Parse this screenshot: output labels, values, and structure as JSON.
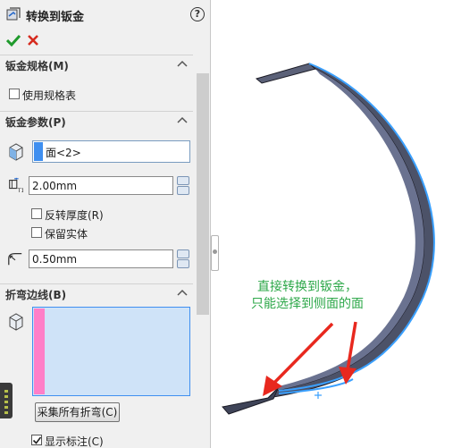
{
  "title": "转换到钣金",
  "icons": {
    "title": "sheetmetal-convert-icon",
    "help": "help-icon",
    "ok": "checkmark-icon",
    "cancel": "cancel-icon"
  },
  "colors": {
    "panel_bg": "#f0f0f0",
    "face_swatch": "#3f8ff0",
    "bend_swatch": "#ff7fc8",
    "bend_list_bg": "#cfe3f8",
    "annotation": "#2ea84a",
    "arrow": "#e8281e",
    "part": "#4c5268",
    "edge_highlight": "#3aa0ff"
  },
  "help_glyph": "?",
  "groups": {
    "gauge": {
      "header": "钣金规格(M)",
      "use_gauge_table": {
        "label": "使用规格表",
        "checked": false
      }
    },
    "params": {
      "header": "钣金参数(P)",
      "fixed_face": "面<2>",
      "thickness": "2.00mm",
      "reverse_thickness": {
        "label": "反转厚度(R)",
        "checked": false
      },
      "keep_body": {
        "label": "保留实体",
        "checked": false
      },
      "bend_radius": "0.50mm"
    },
    "bend_edges": {
      "header": "折弯边线(B)",
      "collect_button": "采集所有折弯(C)",
      "show_callouts": {
        "label": "显示标注(C)",
        "checked": true
      }
    }
  },
  "annotation": {
    "line1": "直接转换到钣金，",
    "line2": "只能选择到侧面的面"
  }
}
